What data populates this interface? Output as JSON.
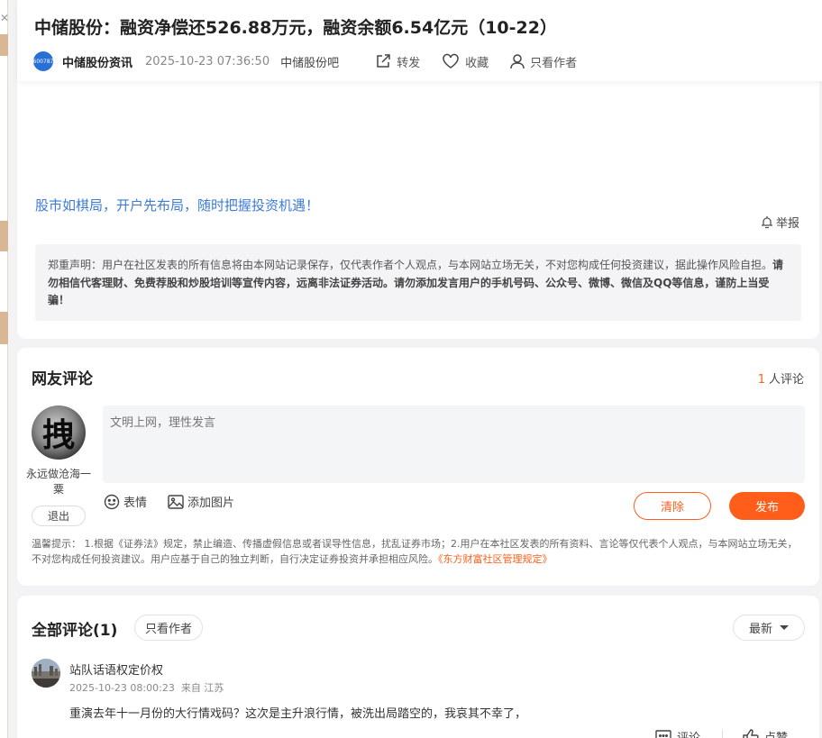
{
  "header": {
    "title": "中储股份：融资净偿还526.88万元，融资余额6.54亿元（10-22）",
    "logo_text": "600787",
    "author": "中储股份资讯",
    "time": "2025-10-23 07:36:50",
    "bar": "中储股份吧",
    "actions": {
      "forward": "转发",
      "favorite": "收藏",
      "only_author": "只看作者"
    }
  },
  "article": {
    "promo": "股市如棋局，开户先布局，随时把握投资机遇！",
    "report": "举报",
    "disclaimer_normal": "郑重声明：用户在社区发表的所有信息将由本网站记录保存，仅代表作者个人观点，与本网站立场无关，不对您构成任何投资建议，据此操作风险自担。",
    "disclaimer_bold": "请勿相信代客理财、免费荐股和炒股培训等宣传内容，远离非法证券活动。请勿添加发言用户的手机号码、公众号、微博、微信及QQ等信息，谨防上当受骗！"
  },
  "comment_box": {
    "title": "网友评论",
    "count": "1",
    "count_suffix": "人评论",
    "avatar_char": "拽",
    "user_name": "永远做沧海一粟",
    "logout": "退出",
    "placeholder": "文明上网，理性发言",
    "emoji": "表情",
    "add_image": "添加图片",
    "clear": "清除",
    "post": "发布",
    "tips_normal": "温馨提示： 1.根据《证券法》规定，禁止编造、传播虚假信息或者误导性信息，扰乱证券市场；2.用户在本社区发表的所有资料、言论等仅代表个人观点，与本网站立场无关，不对您构成任何投资建议。用户应基于自己的独立判断，自行决定证券投资并承担相应风险。",
    "tips_rule": "《东方财富社区管理规定》"
  },
  "all_comments": {
    "title": "全部评论(1)",
    "only_author": "只看作者",
    "sort": "最新",
    "items": [
      {
        "name": "站队话语权定价权",
        "time": "2025-10-23 08:00:23",
        "location": "来自 江苏",
        "text": "重演去年十一月份的大行情戏码？这次是主升浪行情，被洗出局踏空的，我哀其不幸了，",
        "reply": "评论",
        "like": "点赞"
      }
    ]
  }
}
